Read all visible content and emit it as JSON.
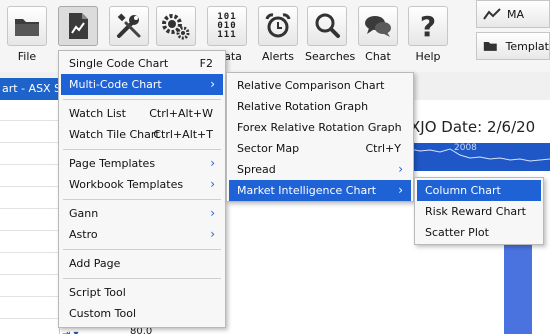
{
  "toolbar": {
    "file": "File",
    "data_partial": "ata",
    "alerts": "Alerts",
    "searches": "Searches",
    "chat": "Chat",
    "help": "Help",
    "ma": "MA",
    "templates_partial": "Templat",
    "binary_rows": [
      "101",
      "010",
      "111"
    ]
  },
  "chart": {
    "title_partial": "art - ASX Sha",
    "header": "XJO   Date: 2/6/20",
    "year_label": "2008",
    "axis_value": "80.0"
  },
  "menu_main": {
    "items": [
      {
        "label": "Single Code Chart",
        "shortcut": "F2"
      },
      {
        "label": "Multi-Code Chart"
      },
      {
        "label": "Watch List",
        "shortcut": "Ctrl+Alt+W"
      },
      {
        "label": "Watch Tile Chart",
        "shortcut": "Ctrl+Alt+T"
      },
      {
        "label": "Page Templates"
      },
      {
        "label": "Workbook Templates"
      },
      {
        "label": "Gann"
      },
      {
        "label": "Astro"
      },
      {
        "label": "Add Page"
      },
      {
        "label": "Script Tool"
      },
      {
        "label": "Custom Tool"
      }
    ]
  },
  "menu_multi": {
    "items": [
      {
        "label": "Relative Comparison Chart"
      },
      {
        "label": "Relative Rotation Graph"
      },
      {
        "label": "Forex Relative Rotation Graph"
      },
      {
        "label": "Sector Map",
        "shortcut": "Ctrl+Y"
      },
      {
        "label": "Spread"
      },
      {
        "label": "Market Intelligence Chart"
      }
    ]
  },
  "menu_mic": {
    "items": [
      {
        "label": "Column Chart"
      },
      {
        "label": "Risk Reward Chart"
      },
      {
        "label": "Scatter Plot"
      }
    ]
  },
  "colors": {
    "accent": "#1f62d6",
    "titlebar": "#1e63c9"
  }
}
